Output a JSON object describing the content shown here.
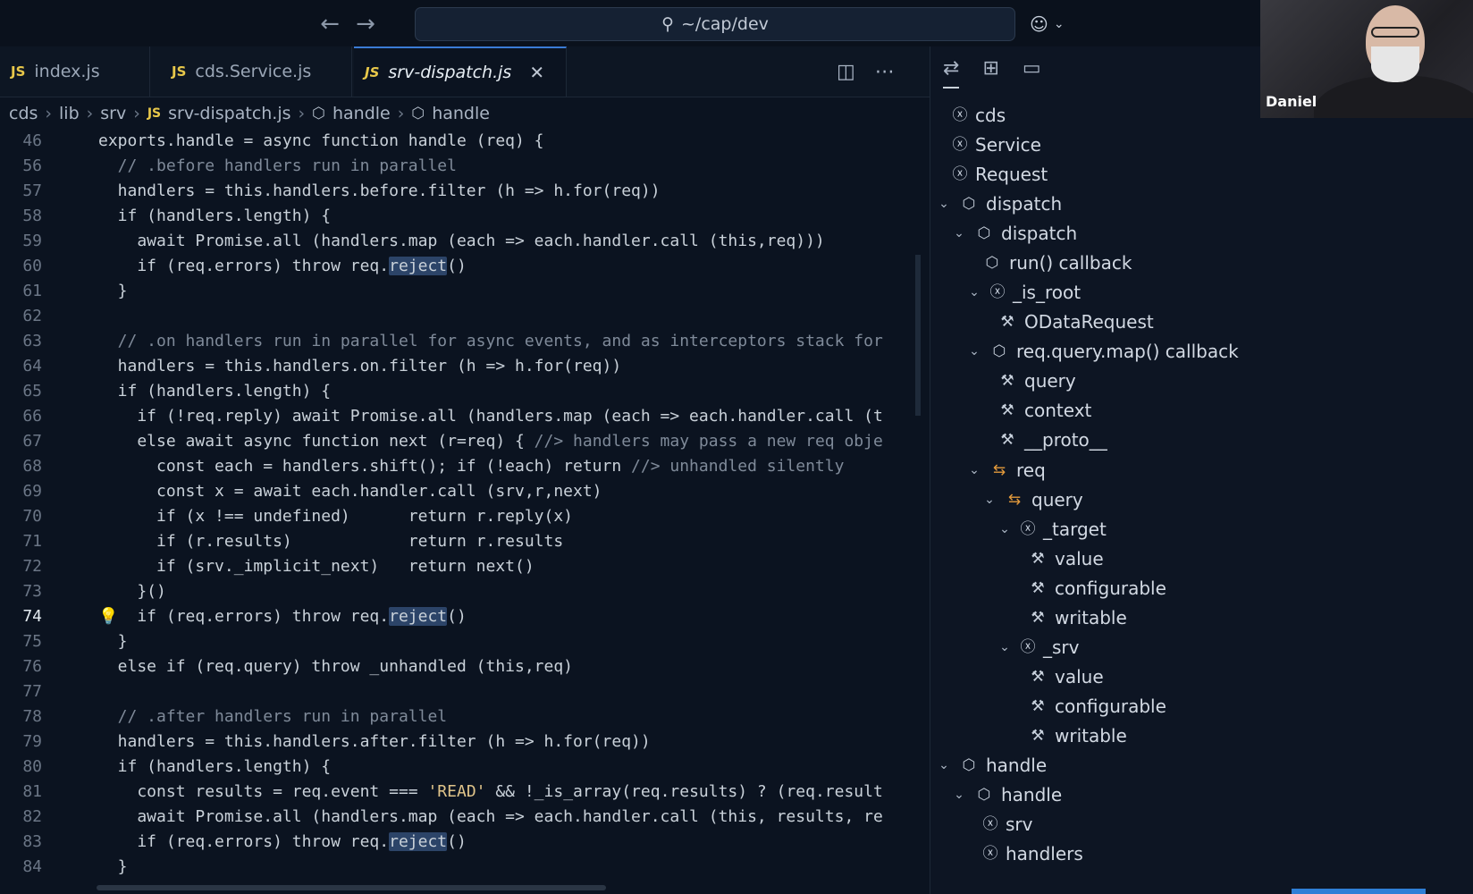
{
  "titlebar": {
    "path": "~/cap/dev"
  },
  "tabs": [
    {
      "label": "index.js",
      "lang": "JS"
    },
    {
      "label": "cds.Service.js",
      "lang": "JS"
    },
    {
      "label": "srv-dispatch.js",
      "lang": "JS",
      "close": "✕"
    }
  ],
  "breadcrumb": [
    "cds",
    "lib",
    "srv",
    "srv-dispatch.js",
    "handle",
    "handle"
  ],
  "webcam": {
    "name": "Daniel"
  },
  "lines": {
    "n46": "46",
    "n56": "56",
    "n57": "57",
    "n58": "58",
    "n59": "59",
    "n60": "60",
    "n61": "61",
    "n62": "62",
    "n63": "63",
    "n64": "64",
    "n65": "65",
    "n66": "66",
    "n67": "67",
    "n68": "68",
    "n69": "69",
    "n70": "70",
    "n71": "71",
    "n72": "72",
    "n73": "73",
    "n74": "74",
    "n75": "75",
    "n76": "76",
    "n77": "77",
    "n78": "78",
    "n79": "79",
    "n80": "80",
    "n81": "81",
    "n82": "82",
    "n83": "83",
    "n84": "84"
  },
  "code": {
    "l46": "exports.handle = async function handle (req) {",
    "l56": "  // .before handlers run in parallel",
    "l57": "  handlers = this.handlers.before.filter (h => h.for(req))",
    "l58": "  if (handlers.length) {",
    "l59": "    await Promise.all (handlers.map (each => each.handler.call (this,req)))",
    "l60a": "    if (req.errors) throw req.",
    "l60b": "reject",
    "l60c": "()",
    "l61": "  }",
    "l63": "  // .on handlers run in parallel for async events, and as interceptors stack for",
    "l64": "  handlers = this.handlers.on.filter (h => h.for(req))",
    "l65": "  if (handlers.length) {",
    "l66": "    if (!req.reply) await Promise.all (handlers.map (each => each.handler.call (t",
    "l67a": "    else await async function next (r=req) { ",
    "l67b": "//> handlers may pass a new req obje",
    "l68a": "      const each = handlers.shift(); if (!each) return ",
    "l68b": "//> unhandled silently",
    "l69": "      const x = await each.handler.call (srv,r,next)",
    "l70": "      if (x !== undefined)      return r.reply(x)",
    "l71": "      if (r.results)            return r.results",
    "l72": "      if (srv._implicit_next)   return next()",
    "l73": "    }()",
    "l74a": "    if (req.errors) throw req.",
    "l74b": "reject",
    "l74c": "()",
    "l75": "  }",
    "l76": "  else if (req.query) throw _unhandled (this,req)",
    "l78": "  // .after handlers run in parallel",
    "l79": "  handlers = this.handlers.after.filter (h => h.for(req))",
    "l80": "  if (handlers.length) {",
    "l81a": "    const results = req.event === ",
    "l81b": "'READ'",
    "l81c": " && !_is_array(req.results) ? (req.result",
    "l82": "    await Promise.all (handlers.map (each => each.handler.call (this, results, re",
    "l83a": "    if (req.errors) throw req.",
    "l83b": "reject",
    "l83c": "()",
    "l84": "  }"
  },
  "outline": [
    {
      "label": "cds",
      "icon": "variable"
    },
    {
      "label": "Service",
      "icon": "variable"
    },
    {
      "label": "Request",
      "icon": "variable"
    },
    {
      "label": "dispatch",
      "icon": "cube",
      "expanded": true
    },
    {
      "label": "dispatch",
      "icon": "cube",
      "expanded": true
    },
    {
      "label": "run() callback",
      "icon": "cube"
    },
    {
      "label": "_is_root",
      "icon": "variable",
      "expanded": true
    },
    {
      "label": "ODataRequest",
      "icon": "wrench"
    },
    {
      "label": "req.query.map() callback",
      "icon": "cube",
      "expanded": true
    },
    {
      "label": "query",
      "icon": "wrench"
    },
    {
      "label": "context",
      "icon": "wrench"
    },
    {
      "label": "__proto__",
      "icon": "wrench"
    },
    {
      "label": "req",
      "icon": "object",
      "expanded": true
    },
    {
      "label": "query",
      "icon": "object",
      "expanded": true
    },
    {
      "label": "_target",
      "icon": "variable",
      "expanded": true
    },
    {
      "label": "value",
      "icon": "wrench"
    },
    {
      "label": "configurable",
      "icon": "wrench"
    },
    {
      "label": "writable",
      "icon": "wrench"
    },
    {
      "label": "_srv",
      "icon": "variable",
      "expanded": true
    },
    {
      "label": "value",
      "icon": "wrench"
    },
    {
      "label": "configurable",
      "icon": "wrench"
    },
    {
      "label": "writable",
      "icon": "wrench"
    },
    {
      "label": "handle",
      "icon": "cube",
      "expanded": true
    },
    {
      "label": "handle",
      "icon": "cube",
      "expanded": true
    },
    {
      "label": "srv",
      "icon": "variable"
    },
    {
      "label": "handlers",
      "icon": "variable"
    }
  ],
  "colors": {
    "accent": "#3a7bd5",
    "selection": "#2c4468",
    "bulb": "#f0c93a",
    "object_icon": "#e39a3c"
  }
}
